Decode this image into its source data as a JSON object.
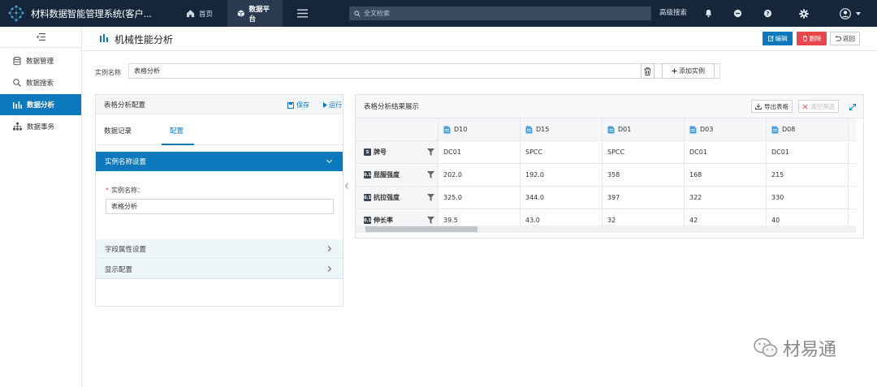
{
  "header": {
    "app_title": "材料数据智能管理系统(客户...",
    "nav": [
      {
        "label": "首页",
        "icon": "home-icon"
      },
      {
        "label": "数据平台",
        "icon": "cube-icon",
        "active": true
      }
    ],
    "search_placeholder": "全文检索",
    "advanced_search": "高级搜索",
    "icons": [
      "bell-icon",
      "message-icon",
      "help-icon",
      "settings-icon",
      "user-avatar-icon"
    ]
  },
  "sidebar": {
    "items": [
      {
        "label": "数据管理",
        "icon": "database-icon"
      },
      {
        "label": "数据搜索",
        "icon": "search-icon"
      },
      {
        "label": "数据分析",
        "icon": "bar-chart-icon",
        "active": true
      },
      {
        "label": "数据事务",
        "icon": "org-chart-icon"
      }
    ]
  },
  "page": {
    "title": "机械性能分析",
    "edit": "编辑",
    "delete": "删除",
    "back": "返回"
  },
  "instance": {
    "label": "实例名称",
    "value": "表格分析",
    "add": "添加实例"
  },
  "config": {
    "title": "表格分析配置",
    "save": "保存",
    "run": "运行",
    "tabs": [
      "数据记录",
      "配置"
    ],
    "active_tab": 1,
    "section_name": "实例名称设置",
    "field_label": "实例名称：",
    "field_value": "表格分析",
    "section_fields": "字段属性设置",
    "section_display": "显示配置"
  },
  "result": {
    "title": "表格分析结果展示",
    "export": "导出表格",
    "clear_filter": "清空筛选",
    "columns": [
      "D10",
      "D15",
      "D01",
      "D03",
      "D08"
    ],
    "rows": [
      {
        "label": "牌号",
        "badge": "S",
        "values": [
          "DC01",
          "SPCC",
          "SPCC",
          "DC01",
          "DC01"
        ]
      },
      {
        "label": "屈服强度",
        "badge": "0.1",
        "values": [
          "202.0",
          "192.0",
          "358",
          "168",
          "215"
        ]
      },
      {
        "label": "抗拉强度",
        "badge": "0.1",
        "values": [
          "325.0",
          "344.0",
          "397",
          "322",
          "330"
        ]
      },
      {
        "label": "伸长率",
        "badge": "0.1",
        "values": [
          "39.5",
          "43.0",
          "32",
          "42",
          "40"
        ]
      }
    ]
  },
  "watermark": "材易通",
  "colors": {
    "topbar": "#15263a",
    "primary": "#0d79bd",
    "danger": "#e8474a"
  }
}
